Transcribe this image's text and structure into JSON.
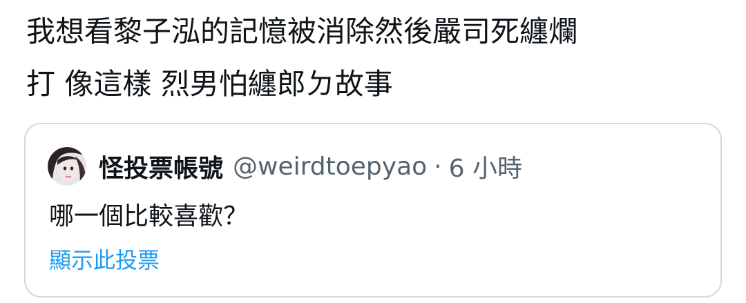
{
  "tweet": {
    "text_line1": "我想看黎子泓的記憶被消除然後嚴司死纏爛",
    "text_line2": "打 像這樣 烈男怕纏郎ㄉ故事"
  },
  "quote": {
    "display_name": "怪投票帳號",
    "handle": "@weirdtoepyao",
    "separator": "·",
    "time": "6 小時",
    "body": "哪一個比較喜歡？",
    "show_poll": "顯示此投票",
    "avatar_icon": "user-avatar-icon"
  },
  "colors": {
    "text_primary": "#0f1419",
    "text_secondary": "#536471",
    "link": "#1d9bf0",
    "border": "#cfd9de"
  }
}
